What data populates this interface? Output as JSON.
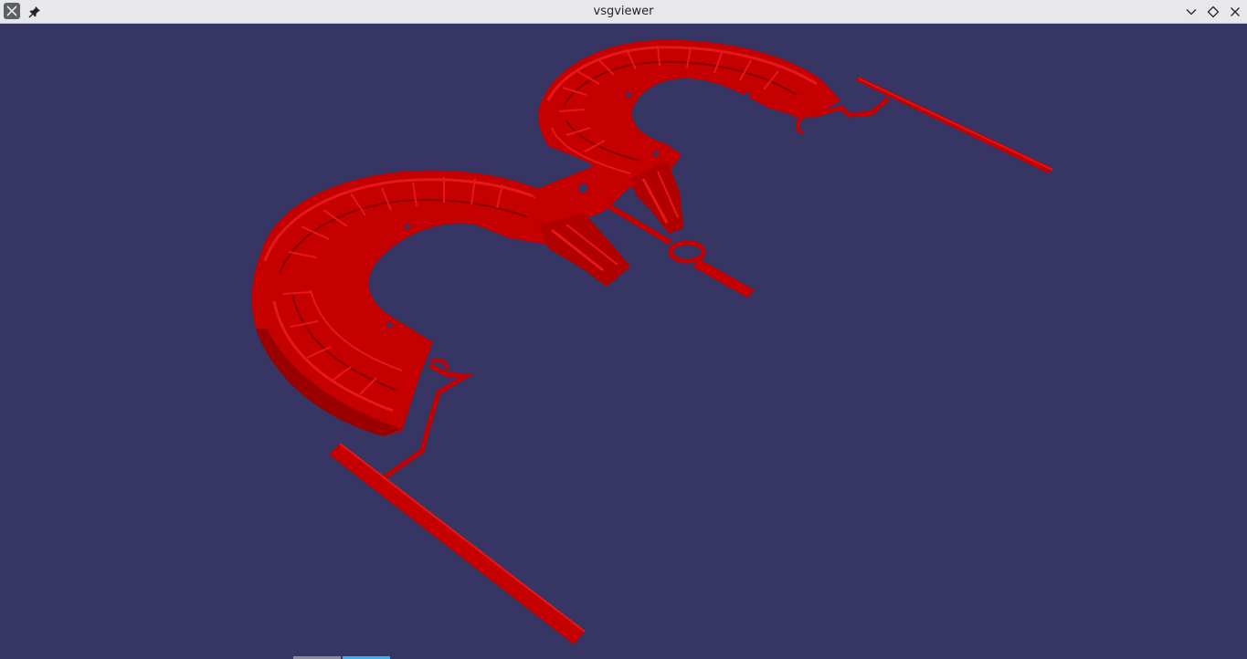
{
  "window": {
    "title": "vsgviewer",
    "app_icon": "vsg-app-icon",
    "controls": [
      "pin-icon",
      "minimize-icon",
      "maximize-icon",
      "close-icon"
    ]
  },
  "viewport": {
    "background_color": "#363563",
    "model_color": "#c40000",
    "model_highlight_color": "#e01010",
    "model_shadow_color": "#8a0000",
    "content": "3d-model-red-part"
  },
  "taskbar_hint": {
    "colors": [
      "#8a8a9a",
      "#3daee9"
    ]
  }
}
